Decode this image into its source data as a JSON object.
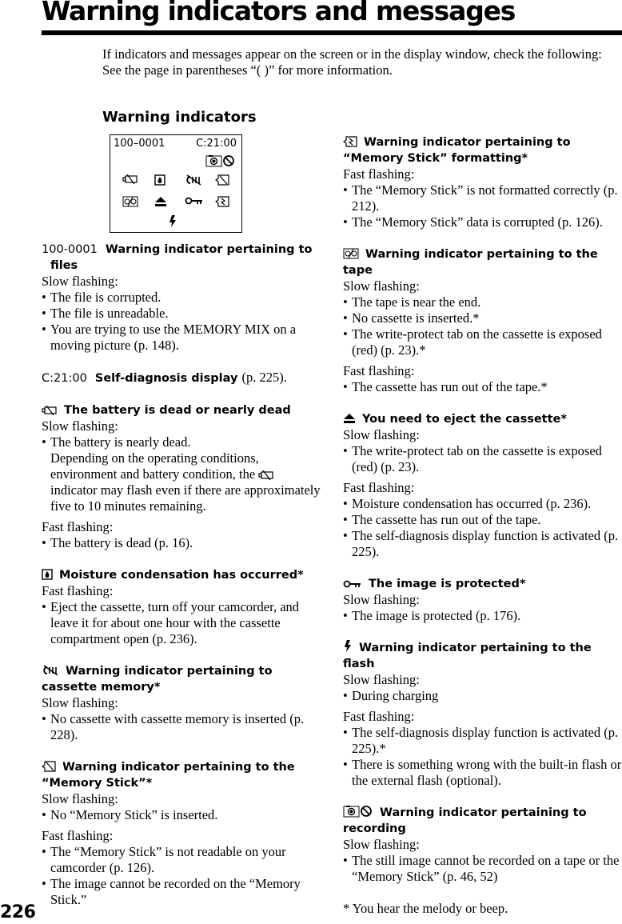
{
  "page": {
    "title": "Warning indicators and messages",
    "page_number": "226",
    "intro": [
      "If indicators and messages appear on the screen or in the display window, check the following:",
      "See the page in parentheses “(    )” for more information."
    ],
    "subheading": "Warning indicators"
  },
  "display_panel": {
    "file_number": "100–0001",
    "self_diag_code": "C:21:00",
    "icons_row0": [
      "camera-record-icon",
      "prohibited-icon"
    ],
    "icons_row1": [
      "battery-dead-icon",
      "moisture-icon",
      "cassette-memory-icon",
      "memory-stick-icon"
    ],
    "icons_row2": [
      "tape-icon",
      "eject-icon",
      "protect-key-icon",
      "memory-stick-format-icon"
    ],
    "icons_row3": [
      "flash-icon"
    ]
  },
  "left_sections": [
    {
      "code": "100-0001",
      "title": "Warning indicator pertaining to files",
      "groups": [
        {
          "label": "Slow flashing:",
          "items": [
            "The file is corrupted.",
            "The file is unreadable.",
            "You are trying to use the MEMORY MIX on a moving picture (p. 148)."
          ]
        }
      ]
    },
    {
      "code": "C:21:00",
      "title": "Self-diagnosis display",
      "ref": "(p. 225)."
    },
    {
      "icon": "battery-dead-icon",
      "title": "The battery is dead or nearly dead",
      "groups": [
        {
          "label": "Slow flashing:",
          "items": [
            "The battery is nearly dead."
          ],
          "note_before_icon": "Depending on the operating conditions, environment and battery condition, the",
          "note_after_icon": "indicator may flash even if there are approximately five to 10 minutes remaining."
        },
        {
          "label": "Fast flashing:",
          "items": [
            "The battery is dead (p. 16)."
          ]
        }
      ]
    },
    {
      "icon": "moisture-icon",
      "title": "Moisture condensation has occurred*",
      "groups": [
        {
          "label": "Fast flashing:",
          "items": [
            "Eject the cassette, turn off your camcorder, and leave it for about one hour with the cassette compartment open (p. 236)."
          ]
        }
      ]
    },
    {
      "icon": "cassette-memory-icon",
      "title": "Warning indicator pertaining to cassette memory*",
      "groups": [
        {
          "label": "Slow flashing:",
          "items": [
            "No cassette with cassette memory is inserted (p. 228)."
          ]
        }
      ]
    },
    {
      "icon": "memory-stick-icon",
      "title": "Warning indicator pertaining to the “Memory Stick”*",
      "groups": [
        {
          "label": "Slow flashing:",
          "items": [
            "No “Memory Stick” is inserted."
          ]
        },
        {
          "label": "Fast flashing:",
          "items": [
            "The “Memory Stick” is not readable on your camcorder (p. 126).",
            "The image cannot be recorded on the “Memory Stick.”"
          ]
        }
      ]
    }
  ],
  "right_sections": [
    {
      "icon": "memory-stick-format-icon",
      "title": "Warning indicator pertaining to “Memory Stick” formatting*",
      "groups": [
        {
          "label": "Fast flashing:",
          "items": [
            "The “Memory Stick” is not formatted correctly (p. 212).",
            "The “Memory Stick” data is corrupted (p. 126)."
          ]
        }
      ]
    },
    {
      "icon": "tape-icon",
      "title": "Warning indicator pertaining to the tape",
      "groups": [
        {
          "label": "Slow flashing:",
          "items": [
            "The tape is near the end.",
            "No cassette is inserted.*",
            "The write-protect tab on the cassette is exposed (red) (p. 23).*"
          ]
        },
        {
          "label": "Fast flashing:",
          "items": [
            "The cassette has run out of the tape.*"
          ]
        }
      ]
    },
    {
      "icon": "eject-icon",
      "title": "You need to eject the cassette*",
      "groups": [
        {
          "label": "Slow flashing:",
          "items": [
            "The write-protect tab on the cassette is exposed (red) (p. 23)."
          ]
        },
        {
          "label": "Fast flashing:",
          "items": [
            "Moisture condensation has occurred (p. 236).",
            "The cassette has run out of the tape.",
            "The self-diagnosis display function is activated (p. 225)."
          ]
        }
      ]
    },
    {
      "icon": "protect-key-icon",
      "title": "The image is protected*",
      "groups": [
        {
          "label": "Slow flashing:",
          "items": [
            "The image is protected (p. 176)."
          ]
        }
      ]
    },
    {
      "icon": "flash-icon",
      "title": "Warning indicator pertaining to the flash",
      "groups": [
        {
          "label": "Slow flashing:",
          "items": [
            "During charging"
          ]
        },
        {
          "label": "Fast flashing:",
          "items": [
            "The self-diagnosis display function is activated (p. 225).*",
            "There is something wrong with the built-in flash or the external flash (optional)."
          ]
        }
      ]
    },
    {
      "icon": "camera-record-prohibited-icon",
      "title": "Warning indicator pertaining to recording",
      "groups": [
        {
          "label": "Slow flashing:",
          "items": [
            " The still image cannot be recorded on a tape or the “Memory Stick” (p. 46, 52)"
          ]
        }
      ]
    }
  ],
  "footnote": "* You hear the melody or beep."
}
